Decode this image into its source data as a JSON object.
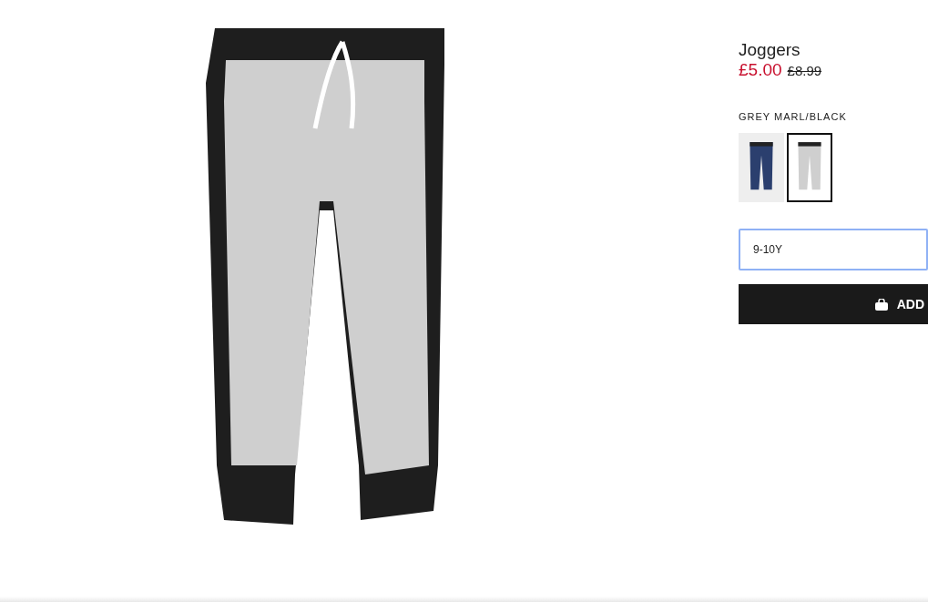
{
  "product": {
    "name": "Joggers",
    "sale_price": "£5.00",
    "original_price": "£8.99",
    "color_name": "GREY MARL/BLACK"
  },
  "swatches": [
    {
      "color": "#2b3f6e",
      "selected": false
    },
    {
      "color": "#cfcfcf",
      "selected": true
    }
  ],
  "size_field": {
    "value": "9-10Y"
  },
  "add_button": {
    "label": "ADD"
  }
}
